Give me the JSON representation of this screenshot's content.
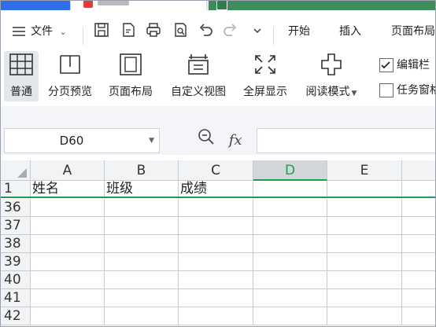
{
  "menu": {
    "file_label": "文件",
    "tabs": [
      "开始",
      "插入",
      "页面布局"
    ]
  },
  "ribbon": {
    "buttons": [
      "普通",
      "分页预览",
      "页面布局",
      "自定义视图",
      "全屏显示",
      "阅读模式"
    ],
    "checkboxes": [
      {
        "label": "编辑栏",
        "checked": true
      },
      {
        "label": "任务窗格",
        "checked": false
      }
    ]
  },
  "formula_bar": {
    "name_box": "D60",
    "fx": "fx",
    "value": ""
  },
  "sheet": {
    "columns": [
      "A",
      "B",
      "C",
      "D",
      "E"
    ],
    "selected_column": "D",
    "header_row": {
      "row": "1",
      "cells": [
        "姓名",
        "班级",
        "成绩",
        "",
        ""
      ]
    },
    "rows": [
      "36",
      "37",
      "38",
      "39",
      "40",
      "41",
      "42"
    ]
  },
  "colors": {
    "accent": "#1f9d55",
    "tab_blue": "#2f6ee8",
    "tab_green": "#3d8c5b"
  }
}
